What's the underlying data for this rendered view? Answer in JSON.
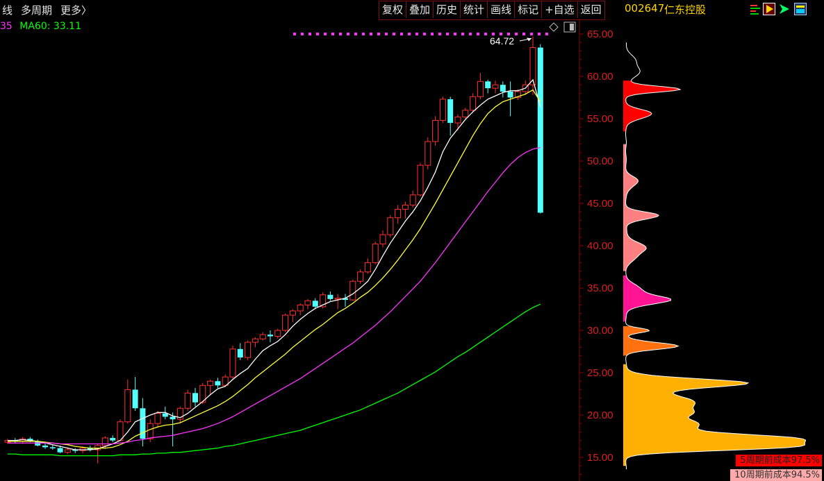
{
  "header": {
    "left_items": [
      "线",
      "多周期",
      "更多〉"
    ],
    "buttons": [
      "复权",
      "叠加",
      "历史",
      "统计",
      "画线",
      "标记",
      "+自选",
      "返回"
    ],
    "stock_code": "002647",
    "stock_name": "仁东控股"
  },
  "ma_legend": {
    "partial": "35",
    "ma60_label": "MA60: 33.11"
  },
  "colors": {
    "up": "#ff3030",
    "down": "#54ffff",
    "ma5": "#ffffff",
    "ma10": "#ffff33",
    "ma20": "#ff33ff",
    "ma60": "#00ff00",
    "axis": "#8b0000",
    "tick_text": "#d92020",
    "profile_early": "#ffb000",
    "profile_mid": "#ff7010",
    "profile_recent_pink": "#ff1493",
    "profile_salmon": "#ff8080",
    "profile_red": "#ff0000",
    "profile_dark": "#b8860b"
  },
  "chart_data": {
    "type": "candlestick",
    "title": "",
    "y_axis": {
      "ticks": [
        "65.00",
        "60.00",
        "55.00",
        "50.00",
        "45.00",
        "40.00",
        "35.00",
        "30.00",
        "25.00",
        "20.00",
        "15.00"
      ],
      "ylim": [
        13,
        67
      ]
    },
    "high_annotation": "64.72",
    "candles_ohlc": [
      [
        16.8,
        17.2,
        16.6,
        17.0
      ],
      [
        17.0,
        17.3,
        16.7,
        16.9
      ],
      [
        16.9,
        17.4,
        16.6,
        17.2
      ],
      [
        17.2,
        17.4,
        16.8,
        16.9
      ],
      [
        16.9,
        17.1,
        16.3,
        16.4
      ],
      [
        16.4,
        16.8,
        16.0,
        16.2
      ],
      [
        16.2,
        16.5,
        15.9,
        16.1
      ],
      [
        16.1,
        16.4,
        15.5,
        15.6
      ],
      [
        15.6,
        16.2,
        15.4,
        15.9
      ],
      [
        15.9,
        16.1,
        15.5,
        15.8
      ],
      [
        15.8,
        16.3,
        15.5,
        16.1
      ],
      [
        16.1,
        16.4,
        15.7,
        15.9
      ],
      [
        15.9,
        16.6,
        14.3,
        16.4
      ],
      [
        16.4,
        17.5,
        16.0,
        17.3
      ],
      [
        17.3,
        17.6,
        16.8,
        17.0
      ],
      [
        17.0,
        19.5,
        16.9,
        19.2
      ],
      [
        19.2,
        24.2,
        19.0,
        23.0
      ],
      [
        23.0,
        24.5,
        20.5,
        20.8
      ],
      [
        20.8,
        22.0,
        16.3,
        17.2
      ],
      [
        17.2,
        19.5,
        16.8,
        19.0
      ],
      [
        19.0,
        20.5,
        18.5,
        20.2
      ],
      [
        20.2,
        21.0,
        19.5,
        19.8
      ],
      [
        19.8,
        20.3,
        16.3,
        19.5
      ],
      [
        19.5,
        21.0,
        19.0,
        20.8
      ],
      [
        20.8,
        23.0,
        20.5,
        22.6
      ],
      [
        22.6,
        23.2,
        21.0,
        21.5
      ],
      [
        21.5,
        23.8,
        21.3,
        23.5
      ],
      [
        23.5,
        24.2,
        22.3,
        24.0
      ],
      [
        24.0,
        24.4,
        23.2,
        23.5
      ],
      [
        23.5,
        24.8,
        23.3,
        24.5
      ],
      [
        24.5,
        28.2,
        24.2,
        27.8
      ],
      [
        27.8,
        28.5,
        26.5,
        26.8
      ],
      [
        26.8,
        28.8,
        26.5,
        28.6
      ],
      [
        28.6,
        29.2,
        28.0,
        29.0
      ],
      [
        29.0,
        29.8,
        28.8,
        29.5
      ],
      [
        29.5,
        30.0,
        28.6,
        29.3
      ],
      [
        29.3,
        30.2,
        29.0,
        30.0
      ],
      [
        30.0,
        32.0,
        29.8,
        31.8
      ],
      [
        31.8,
        32.5,
        31.0,
        32.3
      ],
      [
        32.3,
        33.2,
        31.8,
        33.0
      ],
      [
        33.0,
        33.7,
        32.5,
        33.5
      ],
      [
        33.5,
        33.8,
        32.5,
        32.8
      ],
      [
        32.8,
        34.5,
        32.6,
        34.2
      ],
      [
        34.2,
        34.6,
        33.5,
        33.7
      ],
      [
        33.7,
        34.3,
        32.5,
        33.8
      ],
      [
        33.8,
        34.3,
        32.8,
        33.6
      ],
      [
        33.6,
        36.0,
        33.5,
        35.8
      ],
      [
        35.8,
        37.2,
        35.5,
        36.9
      ],
      [
        36.9,
        38.5,
        36.7,
        38.0
      ],
      [
        38.0,
        40.5,
        37.8,
        40.2
      ],
      [
        40.2,
        41.8,
        39.8,
        41.3
      ],
      [
        41.3,
        43.6,
        41.0,
        43.3
      ],
      [
        43.3,
        44.8,
        42.6,
        44.3
      ],
      [
        44.3,
        45.2,
        43.2,
        44.8
      ],
      [
        44.8,
        46.5,
        44.5,
        46.0
      ],
      [
        46.0,
        49.8,
        45.8,
        49.5
      ],
      [
        49.5,
        52.8,
        49.0,
        52.3
      ],
      [
        52.3,
        55.3,
        51.8,
        54.8
      ],
      [
        54.8,
        57.6,
        54.5,
        57.3
      ],
      [
        57.3,
        57.6,
        53.0,
        54.5
      ],
      [
        54.5,
        55.5,
        53.6,
        55.2
      ],
      [
        55.2,
        56.3,
        55.0,
        56.0
      ],
      [
        56.0,
        58.0,
        55.8,
        57.6
      ],
      [
        57.6,
        60.4,
        57.3,
        59.4
      ],
      [
        59.4,
        59.6,
        58.0,
        58.6
      ],
      [
        58.6,
        59.5,
        58.0,
        59.0
      ],
      [
        59.0,
        59.4,
        57.5,
        58.2
      ],
      [
        58.2,
        59.4,
        55.3,
        57.5
      ],
      [
        57.5,
        58.5,
        57.2,
        58.2
      ],
      [
        58.2,
        59.5,
        57.8,
        59.0
      ],
      [
        59.0,
        64.72,
        57.8,
        63.4
      ],
      [
        63.4,
        63.8,
        43.8,
        43.9
      ]
    ],
    "series": [
      {
        "name": "MA5",
        "values": [
          17.0,
          17.0,
          17.1,
          17.0,
          16.9,
          16.7,
          16.5,
          16.3,
          16.1,
          15.9,
          15.9,
          15.9,
          16.0,
          16.3,
          16.6,
          17.0,
          18.0,
          19.2,
          19.6,
          20.0,
          20.3,
          20.3,
          19.9,
          19.7,
          20.2,
          20.9,
          21.6,
          22.4,
          23.1,
          23.4,
          24.2,
          24.9,
          25.5,
          26.6,
          27.6,
          28.2,
          28.7,
          29.5,
          30.5,
          31.3,
          32.0,
          32.6,
          33.0,
          33.4,
          33.6,
          33.8,
          34.3,
          35.0,
          35.8,
          37.2,
          38.8,
          40.3,
          41.6,
          42.9,
          44.0,
          45.3,
          46.9,
          48.7,
          51.1,
          52.7,
          53.8,
          54.9,
          55.8,
          56.6,
          57.3,
          57.7,
          58.1,
          58.3,
          58.3,
          58.6,
          59.6,
          56.4
        ]
      },
      {
        "name": "MA10",
        "values": [
          16.9,
          16.9,
          16.9,
          16.9,
          16.9,
          16.8,
          16.7,
          16.6,
          16.5,
          16.3,
          16.2,
          16.1,
          16.1,
          16.1,
          16.2,
          16.5,
          16.9,
          17.5,
          17.9,
          18.3,
          18.6,
          18.8,
          18.9,
          19.1,
          19.5,
          19.9,
          20.3,
          20.7,
          21.1,
          21.6,
          22.2,
          22.9,
          23.6,
          24.4,
          25.1,
          25.8,
          26.5,
          27.2,
          28.0,
          28.7,
          29.4,
          30.1,
          30.7,
          31.4,
          32.1,
          32.6,
          33.2,
          33.9,
          34.5,
          35.3,
          36.2,
          37.2,
          38.3,
          39.5,
          40.7,
          42.0,
          43.5,
          45.0,
          46.6,
          48.2,
          49.8,
          51.4,
          53.0,
          54.4,
          55.6,
          56.4,
          57.0,
          57.3,
          57.6,
          57.9,
          58.4,
          57.0
        ]
      },
      {
        "name": "MA20",
        "values": [
          16.7,
          16.7,
          16.7,
          16.7,
          16.7,
          16.7,
          16.7,
          16.6,
          16.6,
          16.6,
          16.6,
          16.6,
          16.6,
          16.6,
          16.6,
          16.7,
          16.8,
          17.0,
          17.1,
          17.3,
          17.4,
          17.5,
          17.6,
          17.8,
          18.0,
          18.2,
          18.4,
          18.7,
          19.0,
          19.4,
          19.8,
          20.3,
          20.8,
          21.3,
          21.8,
          22.3,
          22.8,
          23.3,
          23.8,
          24.3,
          24.9,
          25.5,
          26.1,
          26.7,
          27.3,
          27.9,
          28.5,
          29.2,
          29.9,
          30.6,
          31.4,
          32.2,
          33.1,
          34.0,
          34.9,
          35.8,
          36.9,
          38.0,
          39.2,
          40.4,
          41.6,
          42.8,
          44.0,
          45.2,
          46.4,
          47.5,
          48.6,
          49.6,
          50.4,
          51.0,
          51.4,
          51.6
        ]
      },
      {
        "name": "MA60",
        "values": [
          15.4,
          15.4,
          15.3,
          15.3,
          15.3,
          15.3,
          15.3,
          15.2,
          15.2,
          15.2,
          15.2,
          15.2,
          15.2,
          15.2,
          15.2,
          15.3,
          15.3,
          15.3,
          15.4,
          15.4,
          15.5,
          15.5,
          15.6,
          15.6,
          15.7,
          15.8,
          15.9,
          16.0,
          16.1,
          16.3,
          16.4,
          16.6,
          16.8,
          17.0,
          17.2,
          17.4,
          17.6,
          17.8,
          18.0,
          18.2,
          18.5,
          18.8,
          19.1,
          19.4,
          19.7,
          20.0,
          20.3,
          20.6,
          21.0,
          21.4,
          21.8,
          22.2,
          22.6,
          23.1,
          23.6,
          24.1,
          24.6,
          25.1,
          25.7,
          26.3,
          26.9,
          27.4,
          28.0,
          28.6,
          29.2,
          29.8,
          30.4,
          31.0,
          31.6,
          32.2,
          32.7,
          33.1
        ]
      }
    ],
    "cost_profile": {
      "bands": [
        {
          "color_key": "profile_red",
          "price_range": [
            53.5,
            59.5
          ]
        },
        {
          "color_key": "profile_salmon",
          "price_range": [
            37.0,
            52.0
          ]
        },
        {
          "color_key": "profile_recent_pink",
          "price_range": [
            31.0,
            36.5
          ]
        },
        {
          "color_key": "profile_mid",
          "price_range": [
            27.0,
            30.5
          ]
        },
        {
          "color_key": "profile_early",
          "price_range": [
            14.0,
            26.0
          ]
        }
      ],
      "labels": [
        {
          "text": "5周期前成本97.5%",
          "bg": "#ff0000",
          "fg": "#222222"
        },
        {
          "text": "10周期前成本94.5%",
          "bg": "#ffaaaa",
          "fg": "#333333"
        }
      ]
    }
  }
}
